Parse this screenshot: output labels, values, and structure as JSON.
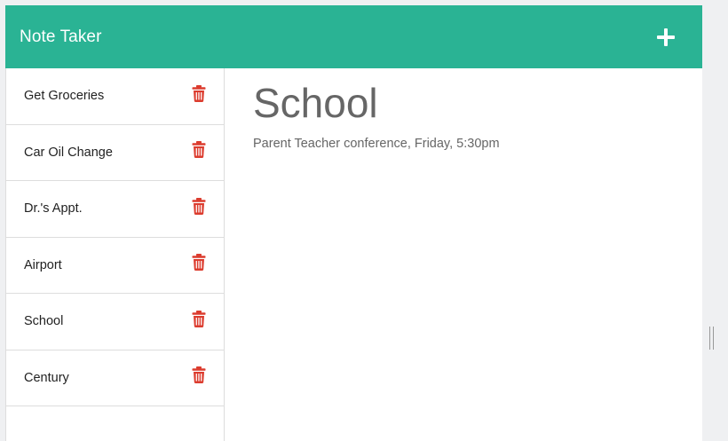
{
  "header": {
    "title": "Note Taker",
    "bg_color": "#2ab394",
    "new_note_icon": "plus-icon"
  },
  "sidebar": {
    "delete_icon": "trash-icon",
    "delete_icon_color": "#dc3c2e",
    "notes": [
      {
        "label": "Get Groceries"
      },
      {
        "label": "Car Oil Change"
      },
      {
        "label": "Dr.'s Appt."
      },
      {
        "label": "Airport"
      },
      {
        "label": "School"
      },
      {
        "label": "Century"
      }
    ]
  },
  "main": {
    "note_title": "School",
    "note_text": "Parent Teacher conference, Friday, 5:30pm"
  }
}
